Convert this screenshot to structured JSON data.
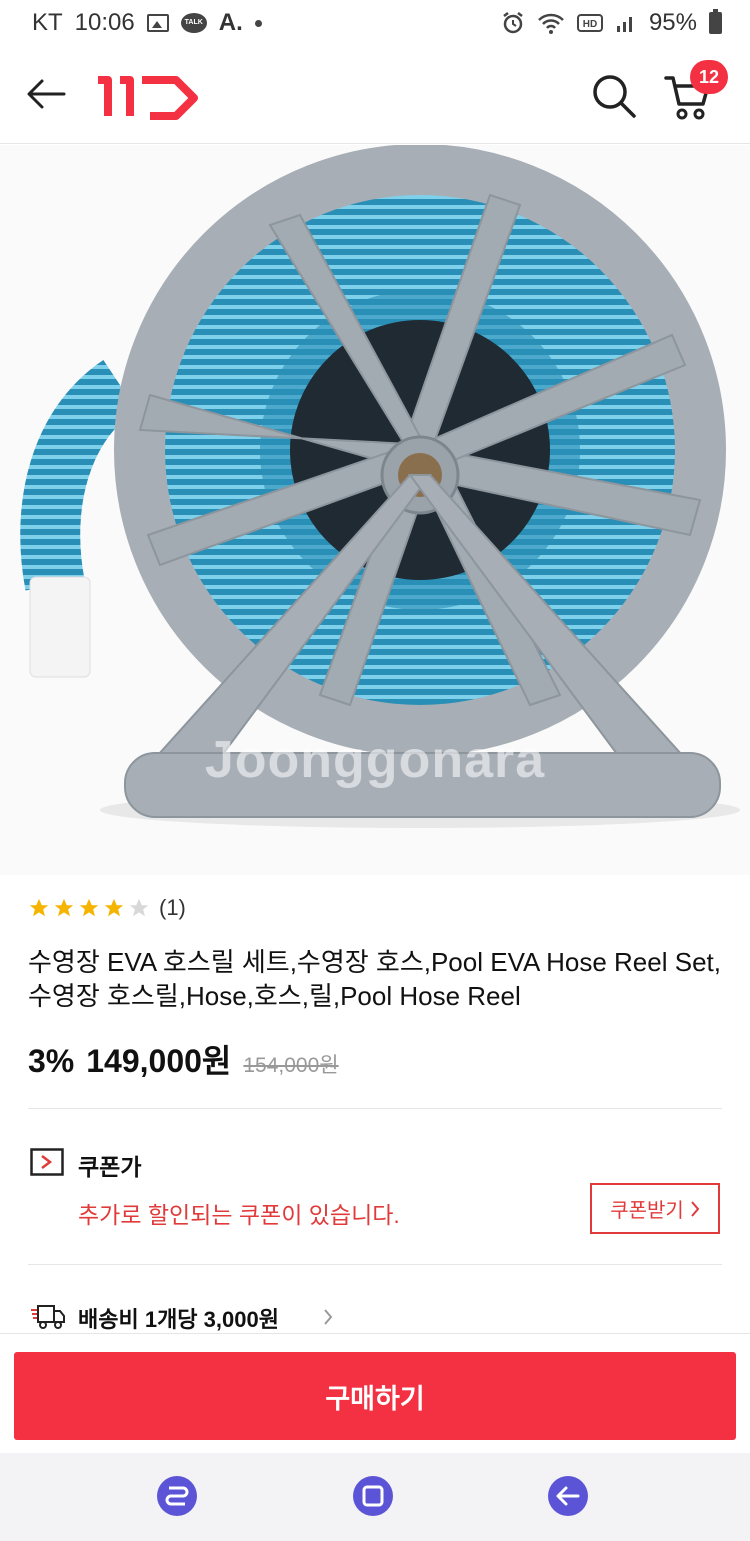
{
  "status_bar": {
    "carrier": "KT",
    "time": "10:06",
    "extra": "A.",
    "battery": "95%"
  },
  "header": {
    "logo_text": "11번가",
    "cart_count": "12"
  },
  "product": {
    "image_watermark": "Joonggonara",
    "rating": 4,
    "rating_max": 5,
    "rating_count": "(1)",
    "title": "수영장 EVA 호스릴 세트,수영장 호스,Pool EVA Hose Reel Set,수영장 호스릴,Hose,호스,릴,Pool Hose Reel",
    "discount": "3%",
    "price": "149,000원",
    "original_price": "154,000원"
  },
  "coupon": {
    "label": "쿠폰가",
    "description": "추가로 할인되는 쿠폰이 있습니다.",
    "button_label": "쿠폰받기"
  },
  "shipping": {
    "label": "배송비 1개당 3,000원"
  },
  "buy_button": "구매하기",
  "colors": {
    "brand": "#f43142",
    "coupon": "#e03a3a",
    "nav_button": "#5b54d6",
    "star": "#f5b400"
  }
}
